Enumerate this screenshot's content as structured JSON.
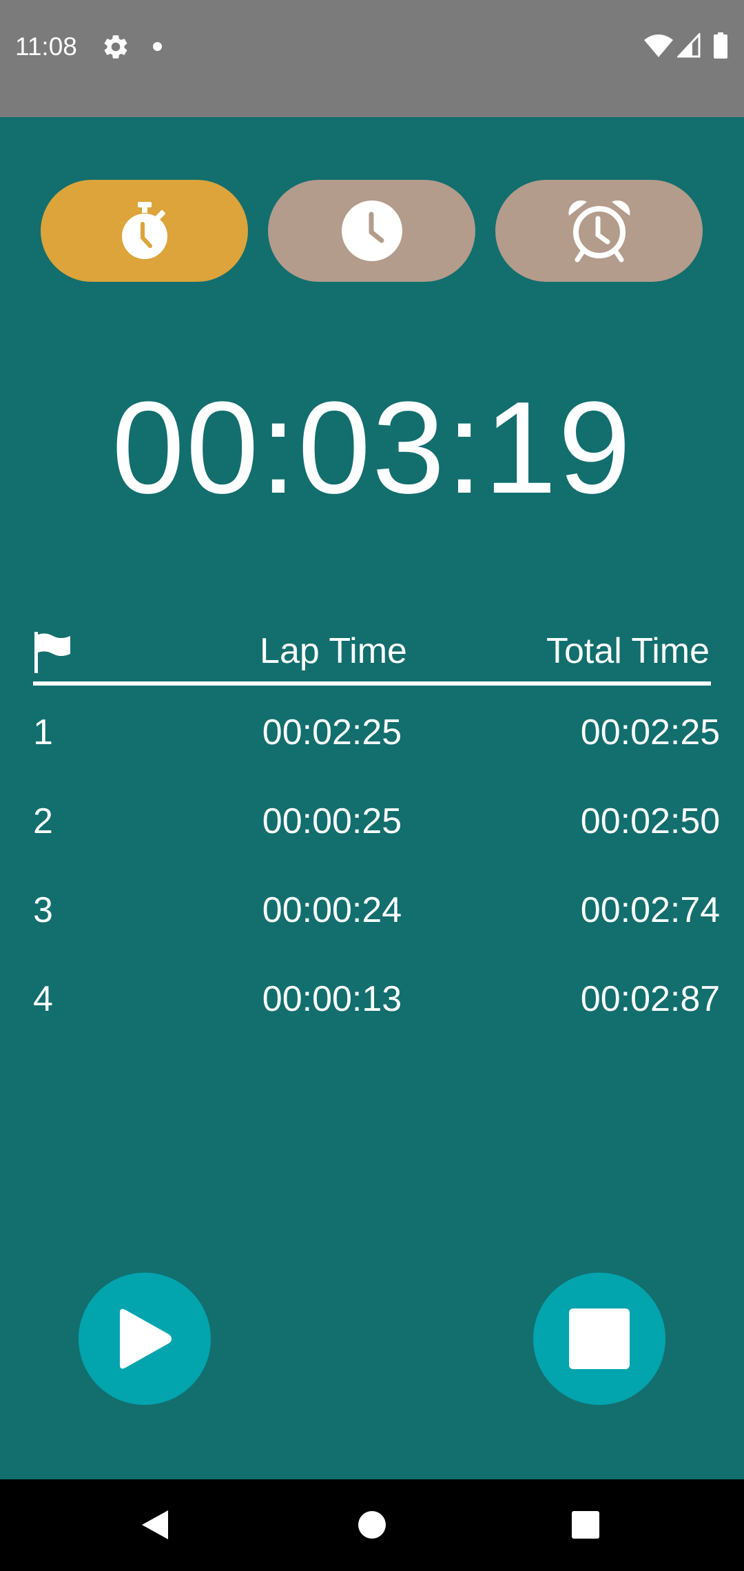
{
  "status_bar": {
    "time": "11:08",
    "icons": [
      "gear-icon",
      "notification-dot-icon",
      "wifi-icon",
      "signal-icon",
      "battery-icon"
    ]
  },
  "colors": {
    "background": "#136E6E",
    "status_bar": "#7B7B7B",
    "tab_active": "#DCA43A",
    "tab_inactive": "#B39C8B",
    "control_button": "#02A4AE",
    "text": "#FFFFFF",
    "nav_bar": "#000000"
  },
  "mode_tabs": [
    {
      "icon": "stopwatch-icon",
      "active": true
    },
    {
      "icon": "clock-icon",
      "active": false
    },
    {
      "icon": "alarm-clock-icon",
      "active": false
    }
  ],
  "stopwatch": {
    "elapsed": "00:03:19"
  },
  "laps": {
    "header_icon": "flag-icon",
    "headers": {
      "lap_time": "Lap Time",
      "total_time": "Total Time"
    },
    "rows": [
      {
        "number": "1",
        "lap_time": "00:02:25",
        "total_time": "00:02:25"
      },
      {
        "number": "2",
        "lap_time": "00:00:25",
        "total_time": "00:02:50"
      },
      {
        "number": "3",
        "lap_time": "00:00:24",
        "total_time": "00:02:74"
      },
      {
        "number": "4",
        "lap_time": "00:00:13",
        "total_time": "00:02:87"
      }
    ]
  },
  "controls": {
    "start_icon": "play-icon",
    "stop_icon": "stop-icon"
  },
  "navigation": {
    "icons": [
      "back-icon",
      "home-icon",
      "recents-icon"
    ]
  }
}
